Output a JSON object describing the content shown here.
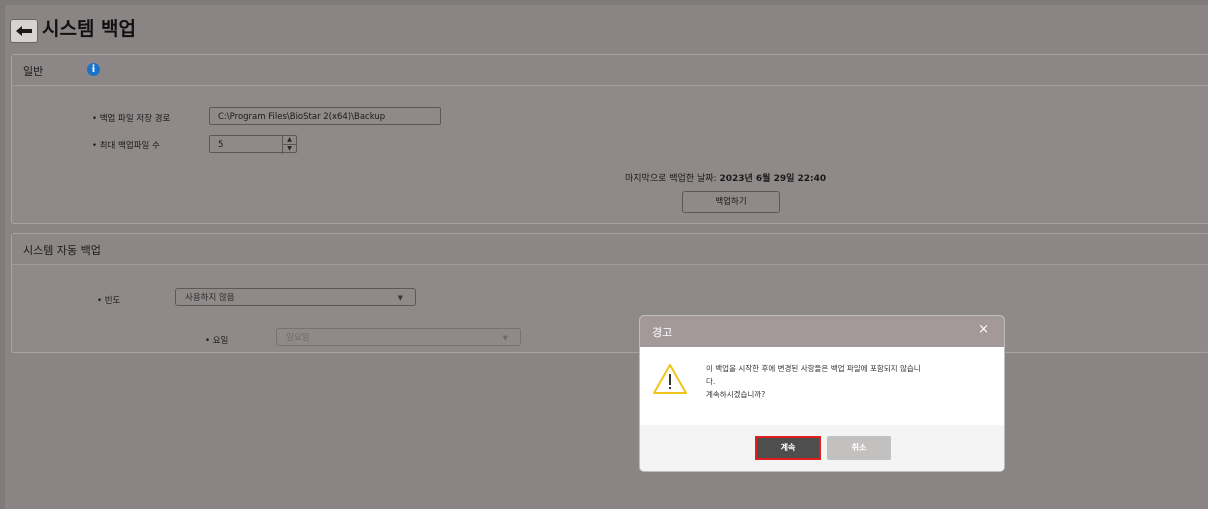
{
  "header": {
    "title": "시스템 백업"
  },
  "general": {
    "title": "일반",
    "path_label": "• 백업 파일 저장 경로",
    "path_value": "C:\\Program Files\\BioStar 2(x64)\\Backup",
    "max_label": "• 최대 백업파일 수",
    "max_value": "5",
    "last_backup_label": "마지막으로 백업한 날짜:",
    "last_backup_value": "2023년 6월 29일 22:40",
    "backup_button": "백업하기"
  },
  "auto": {
    "title": "시스템 자동 백업",
    "freq_label": "• 빈도",
    "freq_value": "사용하지 않음",
    "day_label": "• 요일",
    "day_value": "일요일"
  },
  "dialog": {
    "title": "경고",
    "close": "×",
    "message_line1": "이 백업을 시작한 후에 변경된 사항들은 백업 파일에 포함되지 않습니",
    "message_line2": "다.",
    "message_line3": "계속하시겠습니까?",
    "continue_button": "계속",
    "cancel_button": "취소"
  },
  "colors": {
    "accent_red": "#e0201f",
    "info_blue": "#1b73c8",
    "warning_yellow": "#f0c419"
  }
}
